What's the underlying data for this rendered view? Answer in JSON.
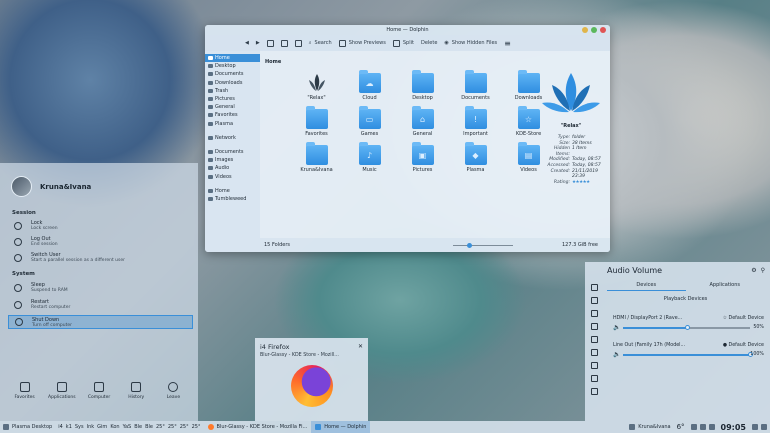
{
  "dolphin": {
    "title": "Home — Dolphin",
    "toolbar": {
      "search": "Search",
      "show_previews": "Show Previews",
      "split": "Split",
      "delete": "Delete",
      "show_hidden": "Show Hidden Files"
    },
    "places": [
      "Home",
      "Desktop",
      "Documents",
      "Downloads",
      "Trash",
      "Pictures",
      "General",
      "Favorites",
      "Plasma",
      "Network",
      "Documents",
      "Images",
      "Audio",
      "Videos",
      "Home",
      "Tumbleweed"
    ],
    "breadcrumb": "Home",
    "folders": [
      {
        "label": "\"Relax\"",
        "icon": "leaf-logo-icon"
      },
      {
        "label": "Cloud",
        "icon": "cloud-folder-icon",
        "glyph": "☁"
      },
      {
        "label": "Desktop",
        "icon": "desktop-folder-icon",
        "glyph": ""
      },
      {
        "label": "Documents",
        "icon": "documents-folder-icon",
        "glyph": ""
      },
      {
        "label": "Downloads",
        "icon": "downloads-folder-icon",
        "glyph": ""
      },
      {
        "label": "Favorites",
        "icon": "favorites-folder-icon",
        "glyph": ""
      },
      {
        "label": "Games",
        "icon": "games-folder-icon",
        "glyph": "▭"
      },
      {
        "label": "General",
        "icon": "general-folder-icon",
        "glyph": "⌂"
      },
      {
        "label": "Important",
        "icon": "important-folder-icon",
        "glyph": "!"
      },
      {
        "label": "KDE-Store",
        "icon": "kde-store-folder-icon",
        "glyph": "☆"
      },
      {
        "label": "Kruna&Ivana",
        "icon": "kruna-ivana-folder-icon",
        "glyph": ""
      },
      {
        "label": "Music",
        "icon": "music-folder-icon",
        "glyph": "♪"
      },
      {
        "label": "Pictures",
        "icon": "pictures-folder-icon",
        "glyph": "▣"
      },
      {
        "label": "Plasma",
        "icon": "plasma-folder-icon",
        "glyph": "◆"
      },
      {
        "label": "Videos",
        "icon": "videos-folder-icon",
        "glyph": "▤"
      }
    ],
    "info": {
      "name": "\"Relax\"",
      "rows": [
        {
          "k": "Type:",
          "v": "folder"
        },
        {
          "k": "Size:",
          "v": "38 Items"
        },
        {
          "k": "Hidden Items:",
          "v": "1 Item"
        },
        {
          "k": "Modified:",
          "v": "Today, 08:57"
        },
        {
          "k": "Accessed:",
          "v": "Today, 08:57"
        },
        {
          "k": "Created:",
          "v": "21/11/2019 23:39"
        }
      ],
      "rating_label": "Rating:",
      "rating_stars": "★★★★★"
    },
    "status": {
      "count": "15 Folders",
      "free": "127.3 GiB free"
    }
  },
  "launcher": {
    "user": "Kruna&Ivana",
    "session_heading": "Session",
    "session": [
      {
        "name": "Lock",
        "desc": "Lock screen"
      },
      {
        "name": "Log Out",
        "desc": "End session"
      },
      {
        "name": "Switch User",
        "desc": "Start a parallel session as a different user"
      }
    ],
    "system_heading": "System",
    "system": [
      {
        "name": "Sleep",
        "desc": "Suspend to RAM"
      },
      {
        "name": "Restart",
        "desc": "Restart computer"
      },
      {
        "name": "Shut Down",
        "desc": "Turn off computer"
      }
    ],
    "tabs": [
      "Favorites",
      "Applications",
      "Computer",
      "History",
      "Leave"
    ]
  },
  "firefox_preview": {
    "title": "i4 Firefox",
    "subtitle": "Blur-Glassy - KDE Store - Mozill..."
  },
  "audio": {
    "title": "Audio Volume",
    "tabs": [
      "Devices",
      "Applications"
    ],
    "section": "Playback Devices",
    "devices": [
      {
        "name": "HDMI / DisplayPort 2 (Rave...",
        "default": "Default Device",
        "pct": "50%",
        "level": 50
      },
      {
        "name": "Line Out (Family 17h (Model...",
        "default": "Default Device",
        "pct": "100%",
        "level": 100
      }
    ]
  },
  "taskbar": {
    "start": "Plasma Desktop",
    "workspace_labels": [
      "i4",
      "k1",
      "Sys",
      "Ink",
      "Gim",
      "Kon",
      "YaS",
      "Ble",
      "Ble",
      "25°",
      "25°",
      "25°",
      "25°"
    ],
    "tasks": [
      "Blur-Glassy - KDE Store - Mozilla Fi...",
      "Home — Dolphin"
    ],
    "user": "Kruna&Ivana",
    "temp": "6°",
    "clock": "09:05"
  },
  "colors": {
    "accent": "#3a8fd8",
    "folder": "#3d9be8"
  }
}
